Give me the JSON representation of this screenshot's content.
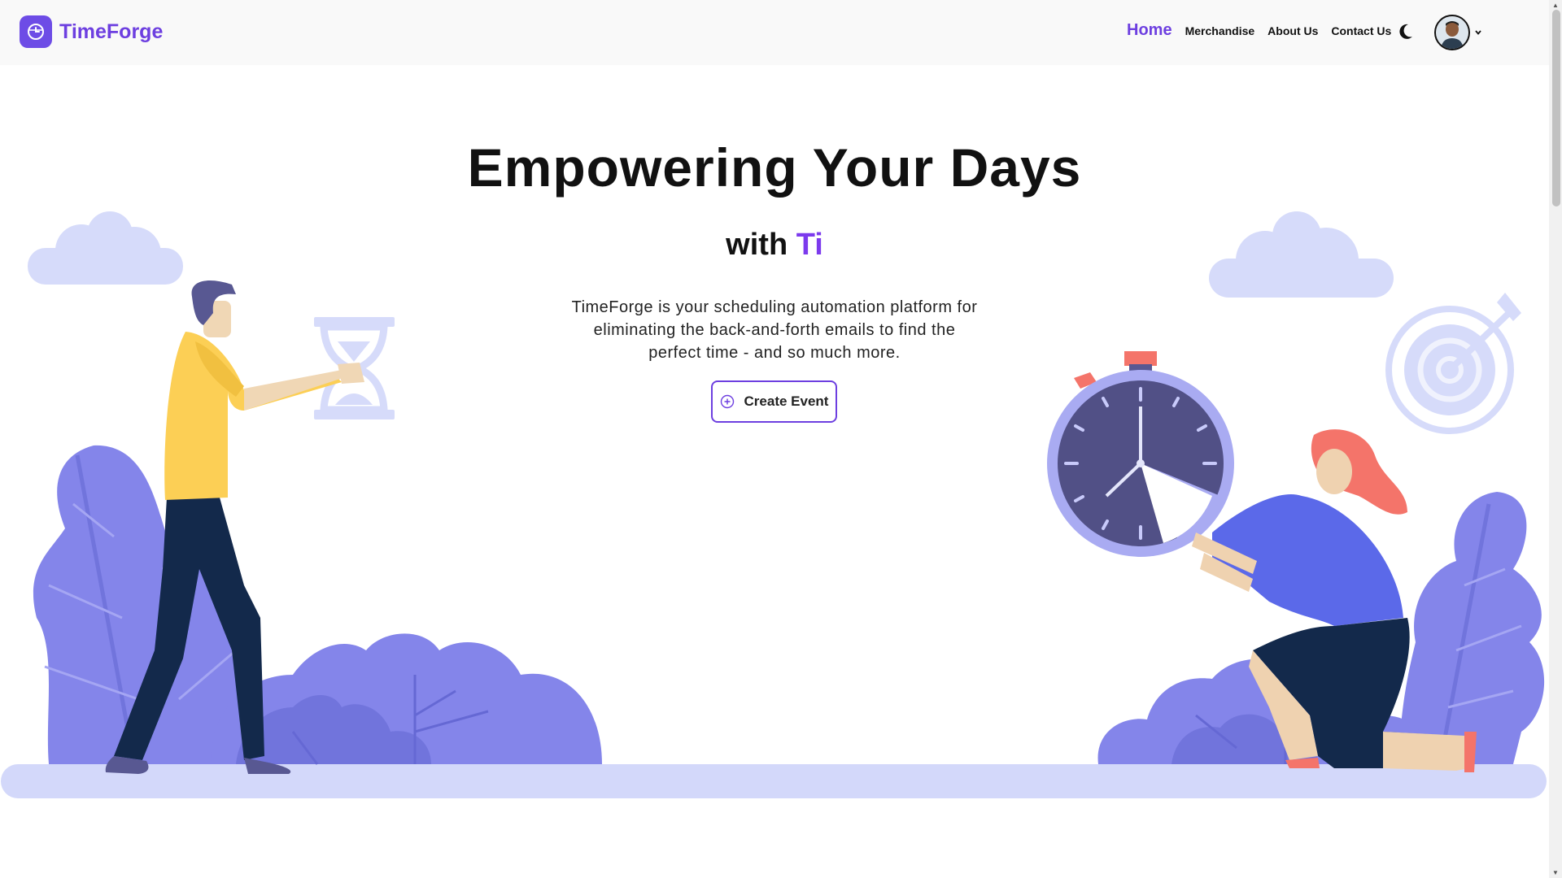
{
  "brand": {
    "name": "TimeForge",
    "logo_icon": "calendar-clock-icon",
    "color": "#6d3fe0"
  },
  "nav": {
    "links": [
      {
        "label": "Home",
        "active": true
      },
      {
        "label": "Merchandise",
        "active": false
      },
      {
        "label": "About Us",
        "active": false
      },
      {
        "label": "Contact Us",
        "active": false
      }
    ],
    "theme_toggle_icon": "moon-icon",
    "avatar_icon": "user-avatar",
    "menu_caret_icon": "chevron-down-icon"
  },
  "hero": {
    "title": "Empowering Your Days",
    "subtitle_prefix": "with",
    "subtitle_highlight": "Ti",
    "description": "TimeForge is your scheduling automation platform for eliminating the back-and-forth emails to find the perfect time - and so much more.",
    "cta_label": "Create Event",
    "cta_icon": "plus-circle-icon"
  },
  "illustration": {
    "left": [
      "cloud",
      "man-holding-hourglass",
      "leaf-bush",
      "round-bush"
    ],
    "right": [
      "cloud",
      "target-arrow",
      "stopwatch",
      "woman-kneeling",
      "leaf-bush",
      "round-bush"
    ]
  },
  "colors": {
    "accent": "#6d3fe0",
    "highlight": "#7c3aed",
    "foliage": "#8b8cf0",
    "foliage_dark": "#7476e0",
    "cloud": "#d6dbfa",
    "ground": "#d3d8fa",
    "navy": "#13294b"
  }
}
